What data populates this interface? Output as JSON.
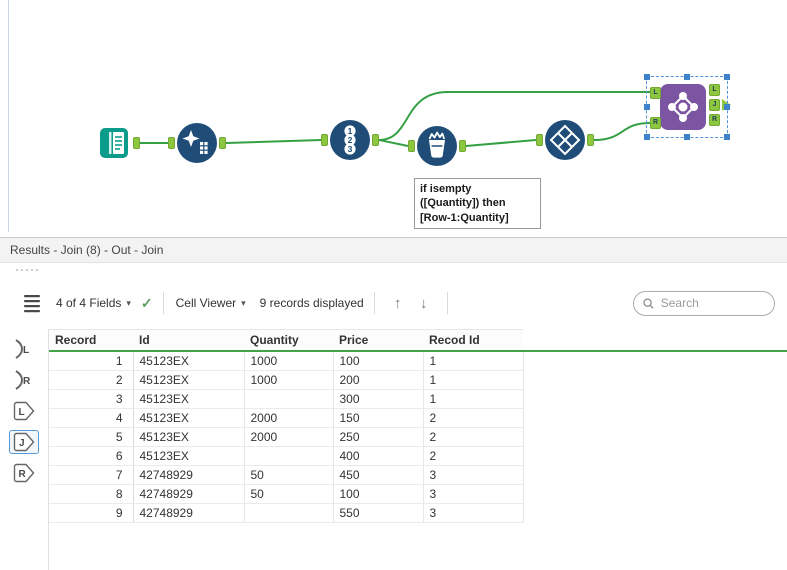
{
  "workflow": {
    "tools": [
      {
        "name": "input-data"
      },
      {
        "name": "data-cleansing"
      },
      {
        "name": "record-id",
        "digits": [
          "1",
          "2",
          "3"
        ]
      },
      {
        "name": "formula"
      },
      {
        "name": "select-records"
      },
      {
        "name": "join",
        "inputs": [
          "L",
          "R"
        ],
        "outputs": [
          "L",
          "J",
          "R"
        ]
      }
    ],
    "annotation": [
      "if isempty",
      "([Quantity]) then",
      "[Row-1:Quantity]"
    ]
  },
  "results": {
    "title": "Results - Join (8) - Out - Join",
    "toolbar": {
      "fields": "4 of 4 Fields",
      "cell_viewer": "Cell Viewer",
      "records": "9 records displayed",
      "search_placeholder": "Search"
    },
    "anchor_strip": [
      {
        "label": "L",
        "kind": "input"
      },
      {
        "label": "R",
        "kind": "input"
      },
      {
        "label": "L",
        "kind": "output"
      },
      {
        "label": "J",
        "kind": "output",
        "selected": true
      },
      {
        "label": "R",
        "kind": "output"
      }
    ],
    "grid": {
      "columns": [
        "Record",
        "Id",
        "Quantity",
        "Price",
        "Recod Id"
      ],
      "rows": [
        [
          "1",
          "45123EX",
          "1000",
          "100",
          "1"
        ],
        [
          "2",
          "45123EX",
          "1000",
          "200",
          "1"
        ],
        [
          "3",
          "45123EX",
          "",
          "300",
          "1"
        ],
        [
          "4",
          "45123EX",
          "2000",
          "150",
          "2"
        ],
        [
          "5",
          "45123EX",
          "2000",
          "250",
          "2"
        ],
        [
          "6",
          "45123EX",
          "",
          "400",
          "2"
        ],
        [
          "7",
          "42748929",
          "50",
          "450",
          "3"
        ],
        [
          "8",
          "42748929",
          "50",
          "100",
          "3"
        ],
        [
          "9",
          "42748929",
          "",
          "550",
          "3"
        ]
      ]
    }
  },
  "icons": {
    "caret": "▾",
    "check": "✓",
    "arrow_up": "↑",
    "arrow_down": "↓"
  },
  "colors": {
    "tool_navy": "#1f4d78",
    "input_teal": "#0b9c8c",
    "join_purple": "#7c55a2",
    "anchor_green": "#8dc63f",
    "wire_green": "#35a043",
    "selection_blue": "#4f93d6",
    "header_underline_green": "#44a248"
  }
}
